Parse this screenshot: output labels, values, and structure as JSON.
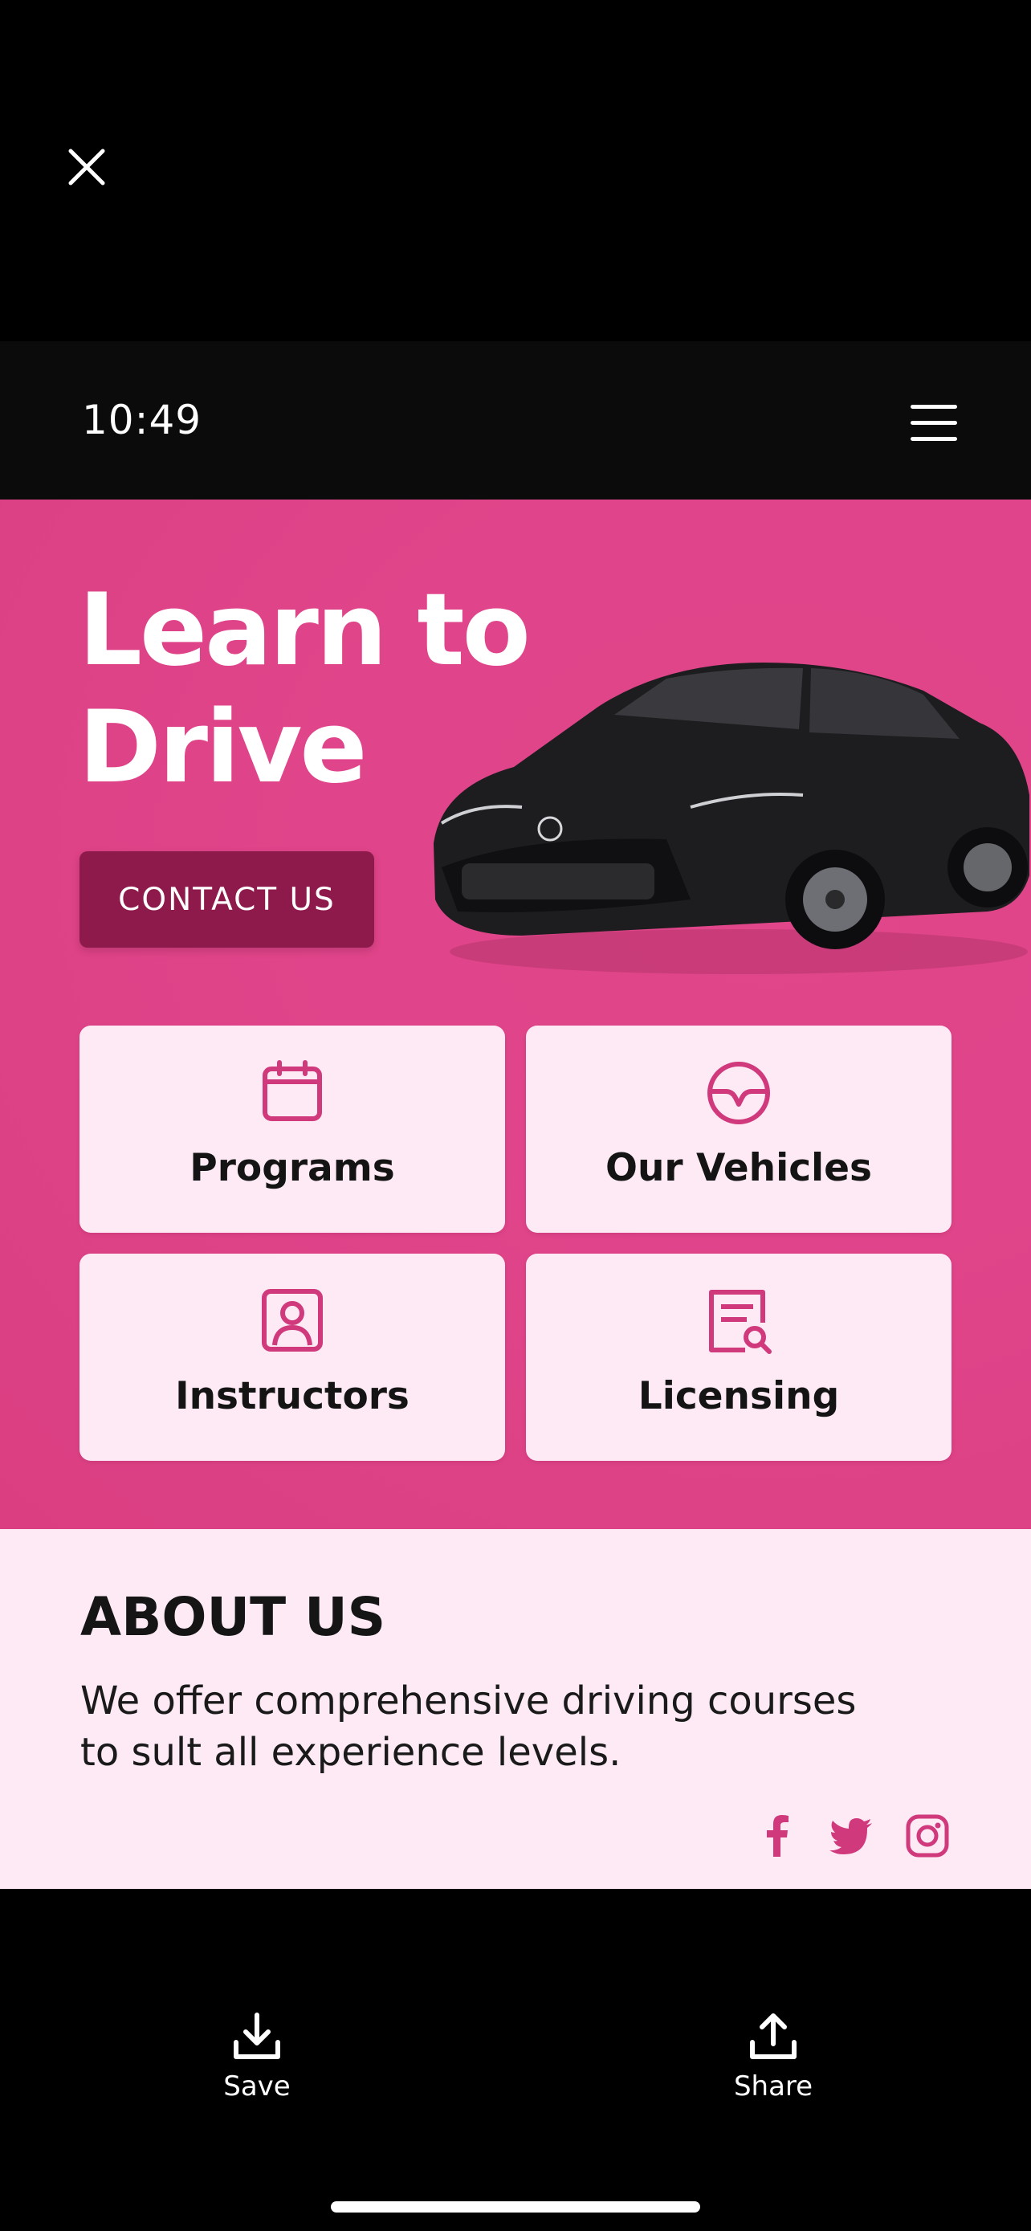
{
  "viewer": {
    "save_label": "Save",
    "share_label": "Share"
  },
  "status_bar": {
    "time": "10:49"
  },
  "hero": {
    "title": "Learn to Drive",
    "cta": "CONTACT US",
    "cards": [
      {
        "label": "Programs",
        "icon": "calendar-icon"
      },
      {
        "label": "Our Vehicles",
        "icon": "steering-wheel-icon"
      },
      {
        "label": "Instructors",
        "icon": "person-badge-icon"
      },
      {
        "label": "Licensing",
        "icon": "document-search-icon"
      }
    ]
  },
  "about": {
    "title": "ABOUT US",
    "text": "We offer comprehensive driving courses to sult all experience levels.",
    "social": [
      "facebook-icon",
      "twitter-icon",
      "instagram-icon"
    ]
  },
  "colors": {
    "accent": "#e0448a",
    "cta": "#8e1a4c",
    "card": "#fdeaf4",
    "about_bg": "#fdeaf5",
    "icon": "#d03a7c"
  }
}
